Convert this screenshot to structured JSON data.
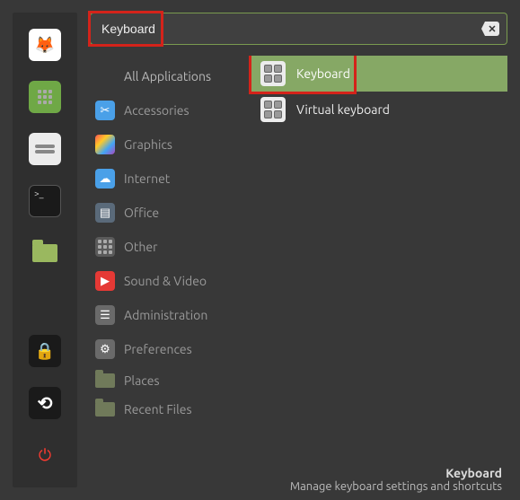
{
  "search": {
    "value": "Keyboard"
  },
  "launcher": [
    {
      "name": "firefox",
      "glyph": "🔥"
    },
    {
      "name": "apps",
      "glyph": ":::"
    },
    {
      "name": "files",
      "glyph": ""
    },
    {
      "name": "terminal",
      "glyph": ""
    },
    {
      "name": "folder",
      "glyph": ""
    },
    {
      "name": "lock",
      "glyph": "🔒"
    },
    {
      "name": "reload",
      "glyph": "⟳"
    },
    {
      "name": "power",
      "glyph": "⏻"
    }
  ],
  "categories": [
    {
      "label": "All Applications",
      "icon": "none"
    },
    {
      "label": "Accessories",
      "icon": "acc",
      "glyph": "✂"
    },
    {
      "label": "Graphics",
      "icon": "gfx",
      "glyph": ""
    },
    {
      "label": "Internet",
      "icon": "net",
      "glyph": "☁"
    },
    {
      "label": "Office",
      "icon": "off",
      "glyph": "📊"
    },
    {
      "label": "Other",
      "icon": "oth",
      "glyph": "grid"
    },
    {
      "label": "Sound & Video",
      "icon": "snd",
      "glyph": "▶"
    },
    {
      "label": "Administration",
      "icon": "adm",
      "glyph": "≣"
    },
    {
      "label": "Preferences",
      "icon": "prf",
      "glyph": "⚙"
    },
    {
      "label": "Places",
      "icon": "plc",
      "glyph": "folder"
    },
    {
      "label": "Recent Files",
      "icon": "rec",
      "glyph": "folder"
    }
  ],
  "results": [
    {
      "label": "Keyboard",
      "selected": true
    },
    {
      "label": "Virtual keyboard",
      "selected": false
    }
  ],
  "footer": {
    "title": "Keyboard",
    "desc": "Manage keyboard settings and shortcuts"
  },
  "highlights": {
    "search": true,
    "first_result": true
  }
}
